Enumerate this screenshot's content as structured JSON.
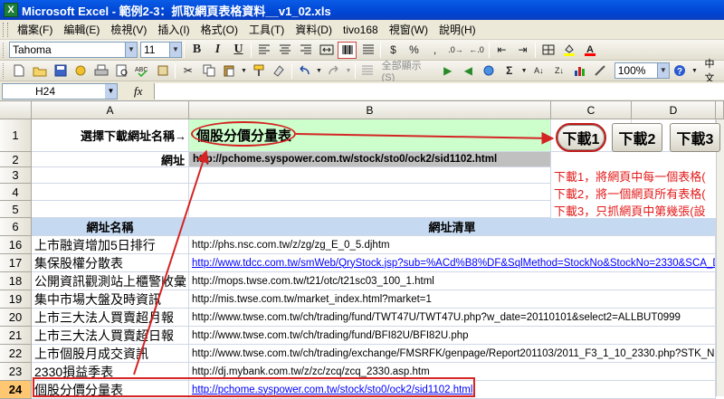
{
  "window": {
    "title": "Microsoft Excel - 範例2-3：抓取網頁表格資料__v1_02.xls",
    "app_icon": "X"
  },
  "menu": [
    "檔案(F)",
    "編輯(E)",
    "檢視(V)",
    "插入(I)",
    "格式(O)",
    "工具(T)",
    "資料(D)",
    "tivo168",
    "視窗(W)",
    "說明(H)"
  ],
  "toolbar1": {
    "font_name": "Tahoma",
    "font_size": "11",
    "bold": "B",
    "italic": "I",
    "underline": "U",
    "currency": "$",
    "percent": "%"
  },
  "toolbar2": {
    "show_all": "全部顯示(S)",
    "zoom": "100%",
    "lang": "中文"
  },
  "formula_bar": {
    "name_box": "H24",
    "fx": "fx",
    "formula": ""
  },
  "columns": [
    "A",
    "B",
    "C",
    "D"
  ],
  "rows": {
    "r1": {
      "num": "1",
      "label": "選擇下載網址名稱→",
      "value": "個股分價分量表"
    },
    "r2": {
      "num": "2",
      "label": "網址",
      "value": "http://pchome.syspower.com.tw/stock/sto0/ock2/sid1102.html"
    },
    "r3": {
      "num": "3"
    },
    "r4": {
      "num": "4"
    },
    "r5": {
      "num": "5"
    },
    "r6": {
      "num": "6",
      "a": "網址名稱",
      "b": "網址清單"
    }
  },
  "buttons": {
    "dl1": "下載1",
    "dl2": "下載2",
    "dl3": "下載3"
  },
  "notes": [
    "下載1，將網頁中每一個表格(",
    "下載2，將一個網頁所有表格(",
    "下載3，只抓網頁中第幾張(設"
  ],
  "list": [
    {
      "num": "16",
      "name": "上市融資增加5日排行",
      "url": "http://phs.nsc.com.tw/z/zg/zg_E_0_5.djhtm",
      "link": false
    },
    {
      "num": "17",
      "name": "集保股權分散表",
      "url": "http://www.tdcc.com.tw/smWeb/QryStock.jsp?sub=%ACd%B8%DF&SqlMethod=StockNo&StockNo=2330&SCA_D",
      "link": true
    },
    {
      "num": "18",
      "name": "公開資訊觀測站上櫃警收彙",
      "url": "http://mops.twse.com.tw/t21/otc/t21sc03_100_1.html",
      "link": false
    },
    {
      "num": "19",
      "name": "集中市場大盤及時資訊",
      "url": "http://mis.twse.com.tw/market_index.html?market=1",
      "link": false
    },
    {
      "num": "20",
      "name": "上市三大法人買賣超月報",
      "url": "http://www.twse.com.tw/ch/trading/fund/TWT47U/TWT47U.php?w_date=20110101&select2=ALLBUT0999",
      "link": false
    },
    {
      "num": "21",
      "name": "上市三大法人買賣超日報",
      "url": "http://www.twse.com.tw/ch/trading/fund/BFI82U/BFI82U.php",
      "link": false
    },
    {
      "num": "22",
      "name": "上市個股月成交資訊",
      "url": "http://www.twse.com.tw/ch/trading/exchange/FMSRFK/genpage/Report201103/2011_F3_1_10_2330.php?STK_NO",
      "link": false
    },
    {
      "num": "23",
      "name": "2330損益季表",
      "url": "http://dj.mybank.com.tw/z/zc/zcq/zcq_2330.asp.htm",
      "link": false
    },
    {
      "num": "24",
      "name": "個股分價分量表",
      "url": "http://pchome.syspower.com.tw/stock/sto0/ock2/sid1102.html",
      "link": true
    }
  ],
  "colors": {
    "header_blue": "#c5d9f1",
    "green": "#ccffcc",
    "gray": "#c0c0c0",
    "red": "#e31b1b",
    "arrow": "#d42424"
  }
}
